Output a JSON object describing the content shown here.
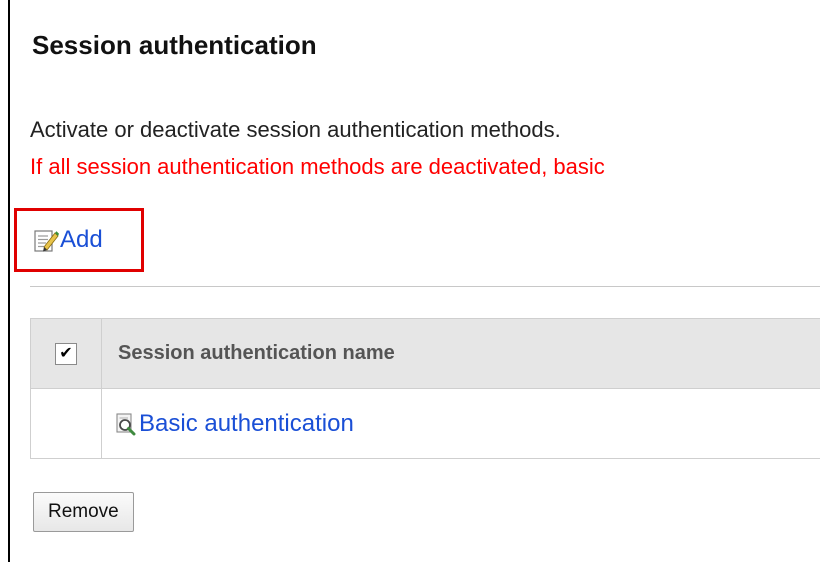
{
  "page": {
    "title": "Session authentication",
    "description": "Activate or deactivate session authentication methods.",
    "warning": "If all session authentication methods are deactivated, basic",
    "warning_color": "#ff0000"
  },
  "toolbar": {
    "add_label": "Add",
    "add_icon": "edit-document-icon",
    "highlight_color": "#e00000"
  },
  "table": {
    "header_checkbox_checked": true,
    "columns": [
      "Session authentication name"
    ],
    "rows": [
      {
        "checked": false,
        "name": "Basic authentication",
        "icon": "magnifier-page-icon"
      }
    ]
  },
  "actions": {
    "remove_label": "Remove"
  },
  "colors": {
    "link": "#1a4fd6",
    "header_bg": "#e6e6e6"
  }
}
